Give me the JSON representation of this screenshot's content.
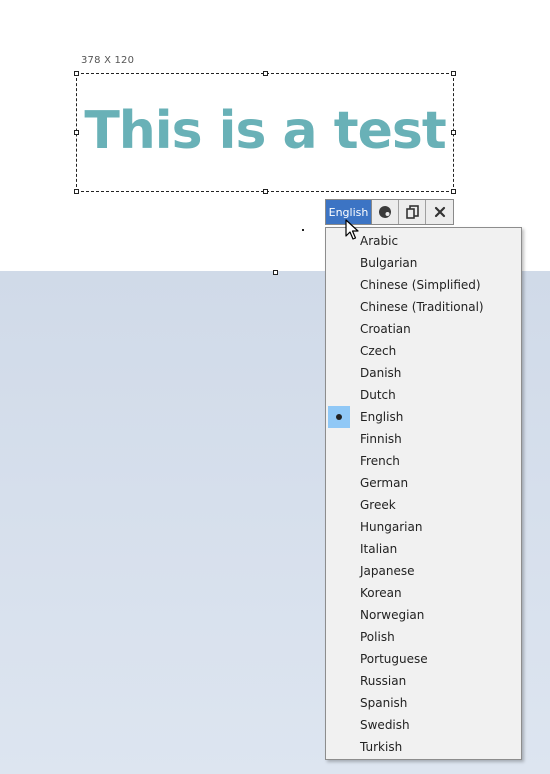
{
  "editor": {
    "size_label": "378 X 120",
    "text": "This is a test",
    "text_color": "#69b1b7"
  },
  "toolbar": {
    "language_button": "English",
    "accent_color": "#3c74c4",
    "icons": [
      "palette-icon",
      "copy-icon",
      "close-icon"
    ]
  },
  "language_menu": {
    "selected": "English",
    "items": [
      {
        "label": "Arabic"
      },
      {
        "label": "Bulgarian"
      },
      {
        "label": "Chinese (Simplified)"
      },
      {
        "label": "Chinese (Traditional)"
      },
      {
        "label": "Croatian"
      },
      {
        "label": "Czech"
      },
      {
        "label": "Danish"
      },
      {
        "label": "Dutch"
      },
      {
        "label": "English"
      },
      {
        "label": "Finnish"
      },
      {
        "label": "French"
      },
      {
        "label": "German"
      },
      {
        "label": "Greek"
      },
      {
        "label": "Hungarian"
      },
      {
        "label": "Italian"
      },
      {
        "label": "Japanese"
      },
      {
        "label": "Korean"
      },
      {
        "label": "Norwegian"
      },
      {
        "label": "Polish"
      },
      {
        "label": "Portuguese"
      },
      {
        "label": "Russian"
      },
      {
        "label": "Spanish"
      },
      {
        "label": "Swedish"
      },
      {
        "label": "Turkish"
      }
    ]
  }
}
